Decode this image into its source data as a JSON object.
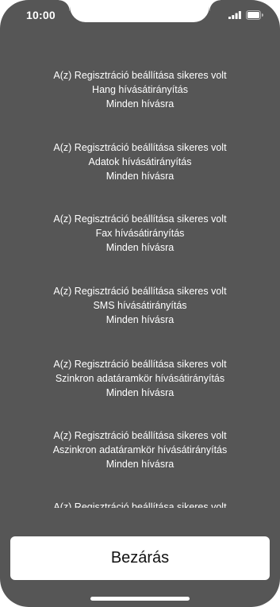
{
  "status_bar": {
    "time": "10:00",
    "icons": [
      "signal-icon",
      "battery-icon"
    ]
  },
  "messages": [
    {
      "line1": "A(z) Regisztráció beállítása sikeres volt",
      "line2": "Hang hívásátirányítás",
      "line3": "Minden hívásra"
    },
    {
      "line1": "A(z) Regisztráció beállítása sikeres volt",
      "line2": "Adatok hívásátirányítás",
      "line3": "Minden hívásra"
    },
    {
      "line1": "A(z) Regisztráció beállítása sikeres volt",
      "line2": "Fax hívásátirányítás",
      "line3": "Minden hívásra"
    },
    {
      "line1": "A(z) Regisztráció beállítása sikeres volt",
      "line2": "SMS hívásátirányítás",
      "line3": "Minden hívásra"
    },
    {
      "line1": "A(z) Regisztráció beállítása sikeres volt",
      "line2": "Szinkron adatáramkör hívásátirányítás",
      "line3": "Minden hívásra"
    },
    {
      "line1": "A(z) Regisztráció beállítása sikeres volt",
      "line2": "Aszinkron adatáramkör hívásátirányítás",
      "line3": "Minden hívásra"
    },
    {
      "line1": "A(z) Regisztráció beállítása sikeres volt",
      "line2": "",
      "line3": ""
    }
  ],
  "close_button": {
    "label": "Bezárás"
  },
  "colors": {
    "background": "#565656",
    "text": "#ffffff",
    "button_background": "#ffffff",
    "button_text": "#111111"
  }
}
